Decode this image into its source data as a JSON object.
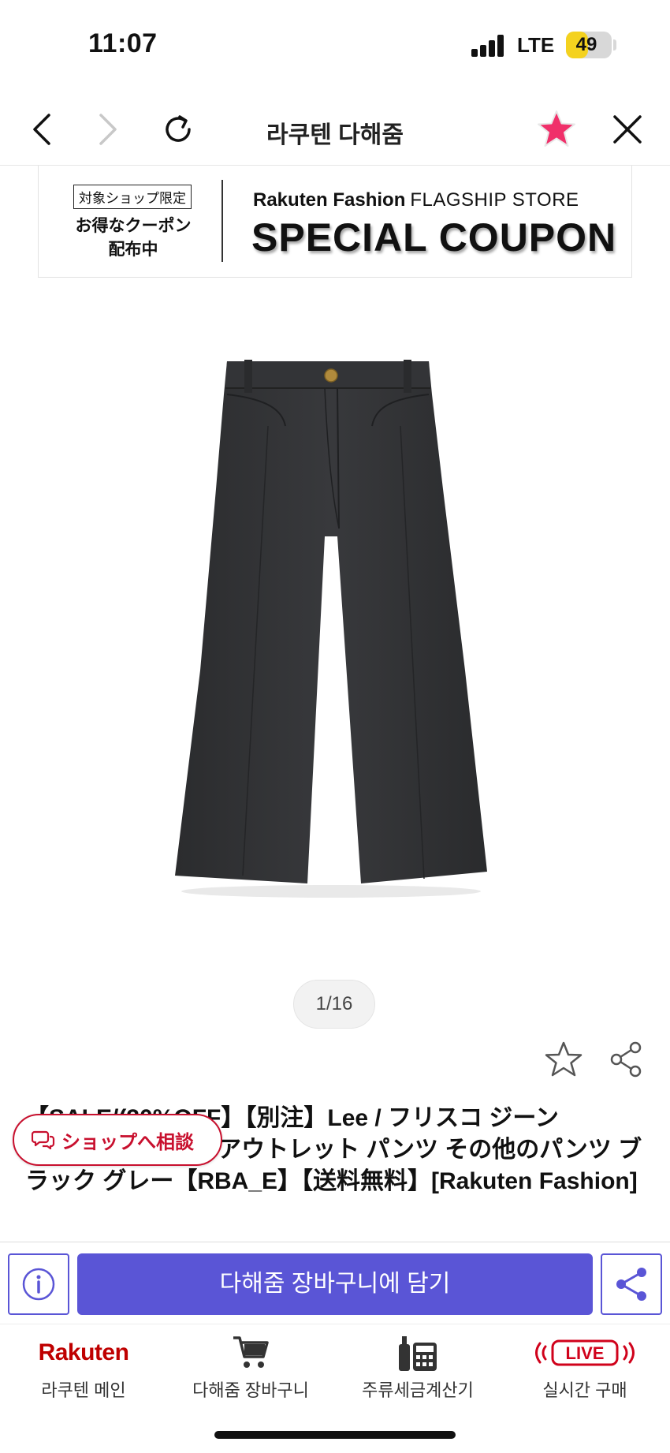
{
  "status_bar": {
    "time": "11:07",
    "network": "LTE",
    "battery": "49",
    "battery_level": 0.49
  },
  "nav": {
    "title": "라쿠텐 다해줌",
    "icons": [
      "chevron-left-icon",
      "chevron-right-icon",
      "refresh-icon",
      "star-icon",
      "close-icon"
    ],
    "favorite_color": "#f0306a"
  },
  "coupon_banner": {
    "tag": "対象ショップ限定",
    "left_line1": "お得なクーポン",
    "left_line2": "配布中",
    "brand": "Rakuten Fashion",
    "brand_sub": "FLAGSHIP STORE",
    "headline": "SPECIAL COUPON"
  },
  "gallery": {
    "counter": "1/16"
  },
  "product": {
    "title": "【SALE/(30%OFF】【別注】Lee / フリスコ ジーンズ ... BEAMS ビームス アウトレット パンツ その他のパンツ ブラック グレー【RBA_E】【送料無料】[Rakuten Fashion]",
    "title_visible": "【SALE/(30%OFF】【別注】Lee / フリスコ ジーン　　　　BEAMS ビームス アウトレット パンツ その他のパンツ ブラック グレー【RBA_E】【送料無料】[Rakuten Fashion]"
  },
  "consult": {
    "label": "ショップへ相談",
    "color": "#c8102e"
  },
  "action_bar": {
    "cart_label": "다해줌 장바구니에 담기",
    "accent": "#5a55d6"
  },
  "tabs": [
    {
      "logo": "Rakuten",
      "label": "라쿠텐 메인",
      "icon": "rakuten-logo"
    },
    {
      "label": "다해줌 장바구니",
      "icon": "cart-icon"
    },
    {
      "label": "주류세금계산기",
      "icon": "calculator-icon"
    },
    {
      "badge": "LIVE",
      "label": "실시간 구매",
      "icon": "live-icon"
    }
  ]
}
